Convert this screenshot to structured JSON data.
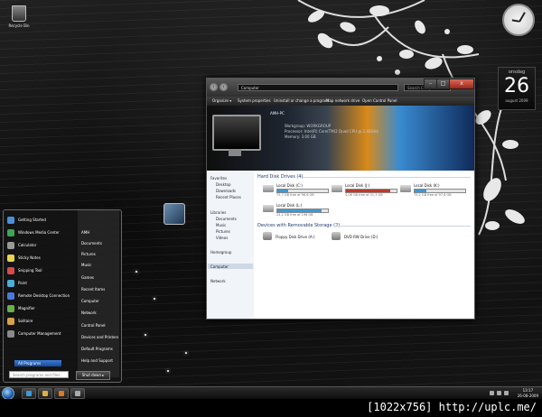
{
  "desktop": {
    "recycle_bin_label": "Recycle Bin",
    "calendar": {
      "weekday": "onsdag",
      "day": "26",
      "month_year": "august 2009"
    }
  },
  "explorer": {
    "address": "Computer",
    "search_placeholder": "Search Computer",
    "window_buttons": {
      "minimize": "–",
      "maximize": "□",
      "close": "x"
    },
    "toolbar": [
      "Organize ▾",
      "System properties",
      "Uninstall or change a program",
      "Map network drive",
      "Open Control Panel"
    ],
    "pc": {
      "name": "AMH-PC",
      "workgroup": "Workgroup: WORKGROUP",
      "processor": "Processor: Intel(R) Core(TM)2 Quad CPU     @ 2.40GHz",
      "memory": "Memory: 3.00 GB"
    },
    "nav": {
      "favorites": "Favorites",
      "favorites_items": [
        "Desktop",
        "Downloads",
        "Recent Places"
      ],
      "libraries": "Libraries",
      "libraries_items": [
        "Documents",
        "Music",
        "Pictures",
        "Videos"
      ],
      "homegroup": "Homegroup",
      "computer": "Computer",
      "network": "Network"
    },
    "hdd_header": "Hard Disk Drives (4)",
    "drives": [
      {
        "name": "Local Disk (C:)",
        "free": "75,7 GB free of 96,6 GB",
        "used_fraction": 0.22,
        "color": "#3a9ad9"
      },
      {
        "name": "Local Disk (J:)",
        "free": "4,08 GB free of 31,3 GB",
        "used_fraction": 0.87,
        "color": "#c0392b"
      },
      {
        "name": "Local Disk (K:)",
        "free": "75,2 GB free of 97,6 GB",
        "used_fraction": 0.23,
        "color": "#3a9ad9"
      },
      {
        "name": "Local Disk (L:)",
        "free": "24,2 GB free of 196 GB",
        "used_fraction": 0.88,
        "color": "#3a9ad9"
      }
    ],
    "removable_header": "Devices with Removable Storage (2)",
    "devices": [
      "Floppy Disk Drive (A:)",
      "DVD RW Drive (D:)"
    ]
  },
  "start_menu": {
    "programs": [
      {
        "label": "Getting Started",
        "color": "#4a90d9"
      },
      {
        "label": "Windows Media Center",
        "color": "#3aa655"
      },
      {
        "label": "Calculator",
        "color": "#999999"
      },
      {
        "label": "Sticky Notes",
        "color": "#e8d44d"
      },
      {
        "label": "Snipping Tool",
        "color": "#d94a4a"
      },
      {
        "label": "Paint",
        "color": "#4ab0d9"
      },
      {
        "label": "Remote Desktop Connection",
        "color": "#4a7ad9"
      },
      {
        "label": "Magnifier",
        "color": "#6ab04a"
      },
      {
        "label": "Solitaire",
        "color": "#d9a04a"
      },
      {
        "label": "Computer Management",
        "color": "#8a8a8a"
      }
    ],
    "right_items": [
      "AMH",
      "Documents",
      "Pictures",
      "Music",
      "Games",
      "Recent Items",
      "Computer",
      "Network",
      "Control Panel",
      "Devices and Printers",
      "Default Programs",
      "Help and Support"
    ],
    "all_programs": "All Programs",
    "search_placeholder": "Search programs and files",
    "shutdown": "Shut down ▸"
  },
  "taskbar": {
    "pinned": [
      {
        "name": "internet-explorer",
        "color": "#3a9ad9"
      },
      {
        "name": "explorer",
        "color": "#e0b040"
      },
      {
        "name": "media-player",
        "color": "#e07a20"
      },
      {
        "name": "app",
        "color": "#aaaaaa"
      }
    ],
    "time": "13:17",
    "date": "26-08-2009"
  },
  "footer_caption": "[1022x756] http://uplc.me/"
}
